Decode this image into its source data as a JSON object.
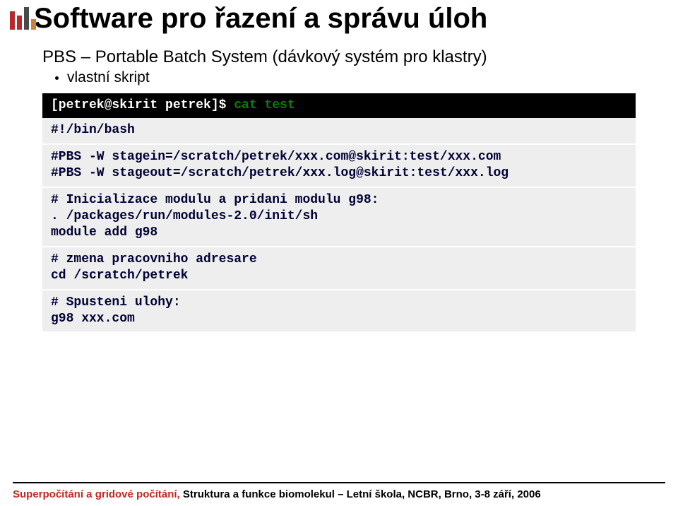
{
  "title": "Software pro řazení a správu úloh",
  "subtitle": "PBS – Portable Batch System (dávkový systém pro klastry)",
  "bullets": {
    "b0": "vlastní skript"
  },
  "terminal": {
    "prompt": "[petrek@skirit petrek]$ ",
    "command": "cat test"
  },
  "script": {
    "shebang": "#!/bin/bash",
    "stagein": "#PBS -W stagein=/scratch/petrek/xxx.com@skirit:test/xxx.com",
    "stageout": "#PBS -W stageout=/scratch/petrek/xxx.log@skirit:test/xxx.log",
    "comment_init": "# Inicializace modulu a pridani modulu g98:",
    "init_source": ". /packages/run/modules-2.0/init/sh",
    "module_add": "module add g98",
    "comment_cd": "# zmena pracovniho adresare",
    "cd_cmd": "cd /scratch/petrek",
    "comment_run": "# Spusteni ulohy:",
    "run_cmd": "g98 xxx.com"
  },
  "footer": {
    "red": "Superpočítání a gridové počítání, ",
    "black": "Struktura a funkce biomolekul – Letní škola, NCBR, Brno, 3-8 září, 2006"
  }
}
